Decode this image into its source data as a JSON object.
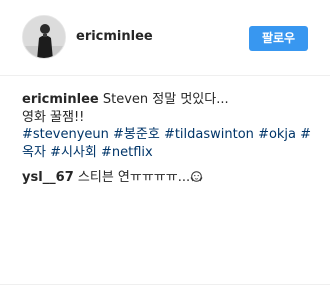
{
  "post": {
    "author": "ericminlee",
    "follow_label": "팔로우"
  },
  "caption": {
    "author": "ericminlee",
    "line1": " Steven 정말 멋있다...",
    "line2": "영화 꿀잼!!",
    "hashtags": [
      "#stevenyeun",
      "#봉준호",
      "#tildaswinton",
      "#okja",
      "#옥자",
      "#시사회",
      "#netflix"
    ]
  },
  "comments": [
    {
      "author": "ysl__67",
      "text": " 스티븐 연ㅠㅠㅠㅠ...",
      "emoji": "face-with-hands-emoji"
    }
  ],
  "colors": {
    "follow_button": "#3897f0",
    "hashtag": "#003569",
    "text": "#262626"
  }
}
